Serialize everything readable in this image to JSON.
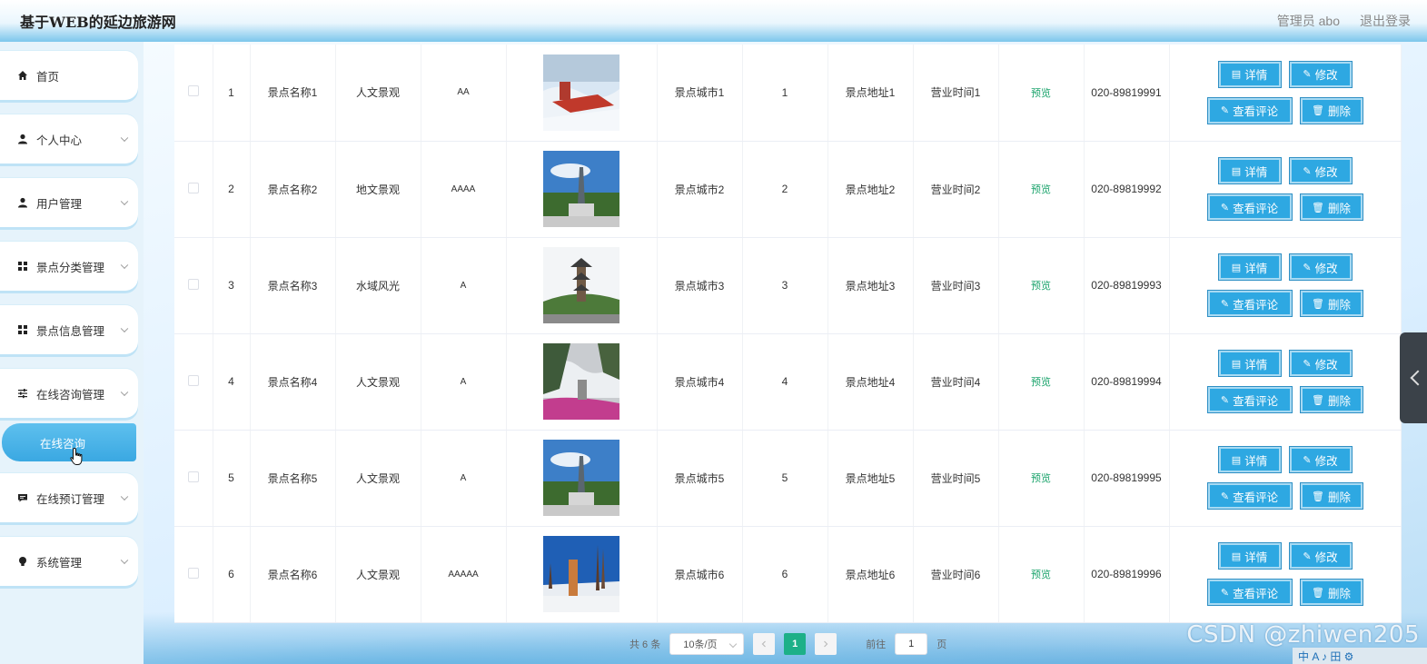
{
  "header": {
    "brand": "基于WEB的延边旅游网",
    "admin_label": "管理员 abo",
    "logout": "退出登录"
  },
  "sidebar": {
    "items": [
      {
        "label": "首页",
        "icon": "home-icon"
      },
      {
        "label": "个人中心",
        "icon": "user-icon"
      },
      {
        "label": "用户管理",
        "icon": "user-icon"
      },
      {
        "label": "景点分类管理",
        "icon": "grid-icon"
      },
      {
        "label": "景点信息管理",
        "icon": "grid-icon"
      },
      {
        "label": "在线咨询管理",
        "icon": "sliders-icon"
      },
      {
        "label": "在线预订管理",
        "icon": "chat-icon"
      },
      {
        "label": "系统管理",
        "icon": "bulb-icon"
      }
    ],
    "active_sub": "在线咨询"
  },
  "table": {
    "rows": [
      {
        "no": "1",
        "name": "景点名称1",
        "category": "人文景观",
        "level": "AA",
        "city": "景点城市1",
        "num": "1",
        "address": "景点地址1",
        "hours": "营业时间1",
        "preview": "预览",
        "phone": "020-89819991",
        "image": "snowy-park"
      },
      {
        "no": "2",
        "name": "景点名称2",
        "category": "地文景观",
        "level": "AAAA",
        "city": "景点城市2",
        "num": "2",
        "address": "景点地址2",
        "hours": "营业时间2",
        "preview": "预览",
        "phone": "020-89819992",
        "image": "monument"
      },
      {
        "no": "3",
        "name": "景点名称3",
        "category": "水域风光",
        "level": "A",
        "city": "景点城市3",
        "num": "3",
        "address": "景点地址3",
        "hours": "营业时间3",
        "preview": "预览",
        "phone": "020-89819993",
        "image": "pagoda"
      },
      {
        "no": "4",
        "name": "景点名称4",
        "category": "人文景观",
        "level": "A",
        "city": "景点城市4",
        "num": "4",
        "address": "景点地址4",
        "hours": "营业时间4",
        "preview": "预览",
        "phone": "020-89819994",
        "image": "misty-flowers"
      },
      {
        "no": "5",
        "name": "景点名称5",
        "category": "人文景观",
        "level": "A",
        "city": "景点城市5",
        "num": "5",
        "address": "景点地址5",
        "hours": "营业时间5",
        "preview": "预览",
        "phone": "020-89819995",
        "image": "monument"
      },
      {
        "no": "6",
        "name": "景点名称6",
        "category": "人文景观",
        "level": "AAAAA",
        "city": "景点城市6",
        "num": "6",
        "address": "景点地址6",
        "hours": "营业时间6",
        "preview": "预览",
        "phone": "020-89819996",
        "image": "winter-tower"
      }
    ],
    "actions": {
      "detail": "详情",
      "edit": "修改",
      "comments": "查看评论",
      "delete": "删除"
    }
  },
  "pager": {
    "total": "共 6 条",
    "page_size": "10条/页",
    "current": "1",
    "goto_label": "前往",
    "goto_value": "1",
    "page_unit": "页"
  },
  "watermark": "CSDN @zhiwen205",
  "tray": "中 A ♪ 田 ⚙"
}
